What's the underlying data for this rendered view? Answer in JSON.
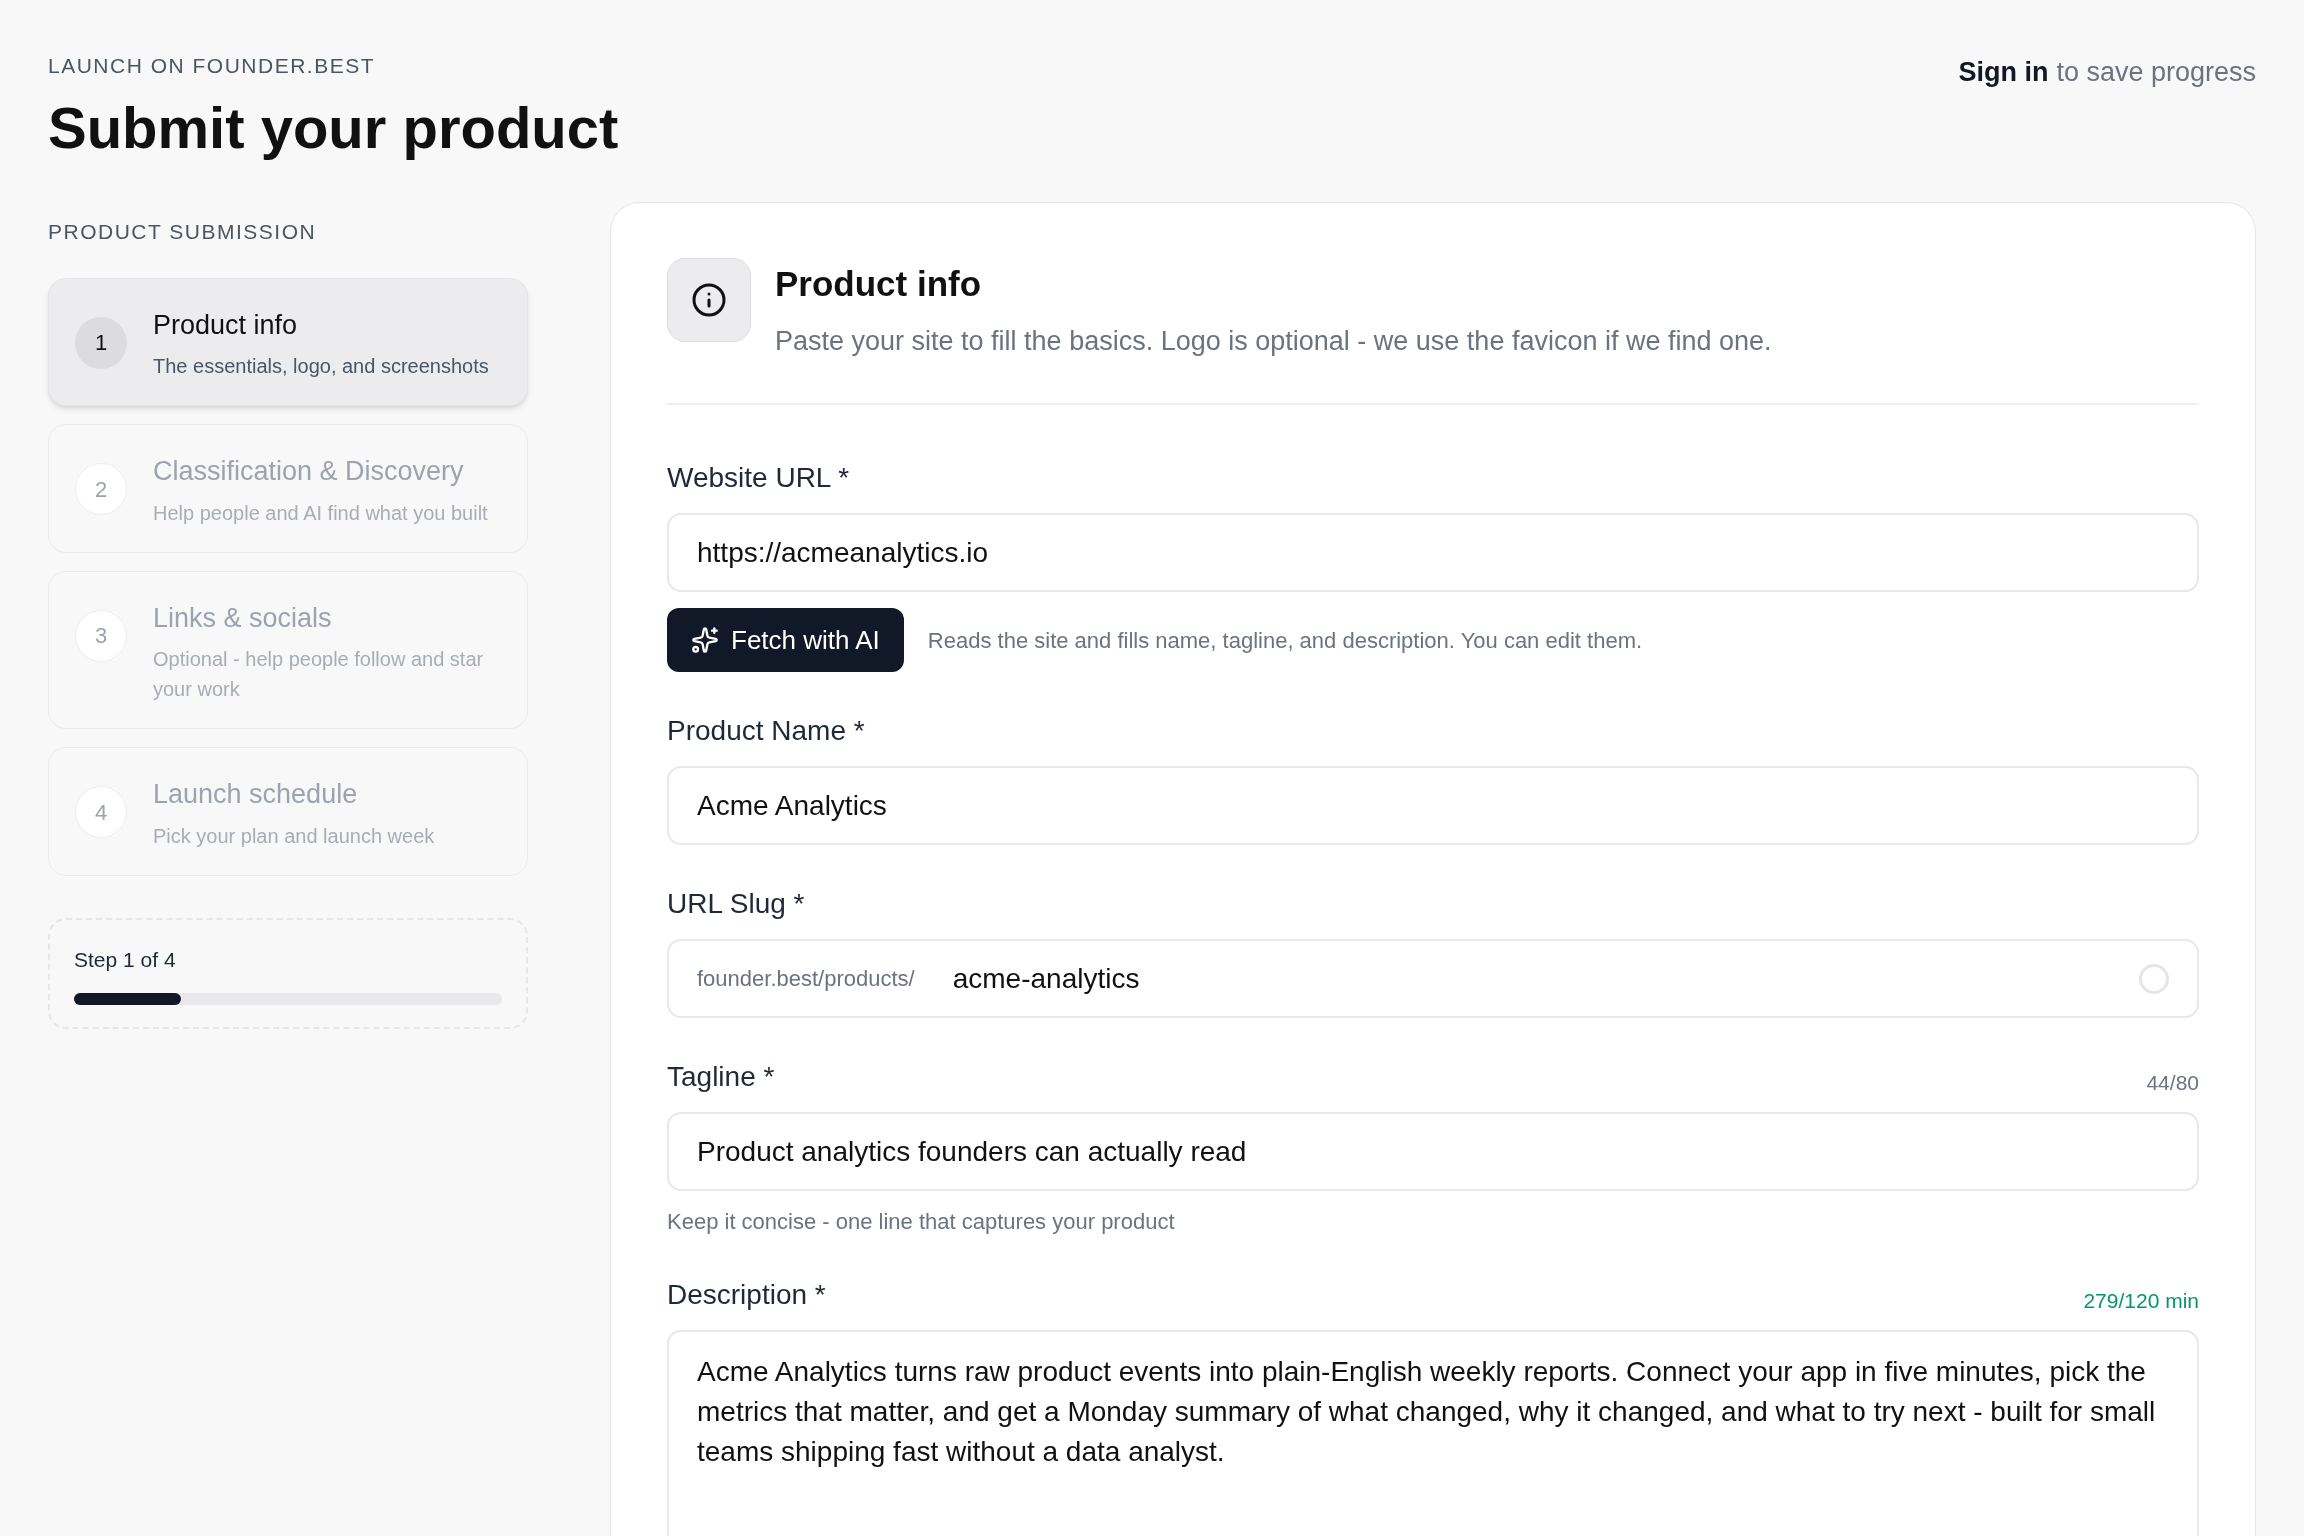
{
  "header": {
    "eyebrow": "LAUNCH ON FOUNDER.BEST",
    "title": "Submit your product",
    "signin_link": "Sign in",
    "signin_suffix": "to save progress"
  },
  "sidebar": {
    "heading": "PRODUCT SUBMISSION",
    "steps": [
      {
        "number": "1",
        "title": "Product info",
        "subtitle": "The essentials, logo, and screenshots",
        "selected": true
      },
      {
        "number": "2",
        "title": "Classification & Discovery",
        "subtitle": "Help people and AI find what you built",
        "selected": false
      },
      {
        "number": "3",
        "title": "Links & socials",
        "subtitle": "Optional - help people follow and star your work",
        "selected": false
      },
      {
        "number": "4",
        "title": "Launch schedule",
        "subtitle": "Pick your plan and launch week",
        "selected": false
      }
    ],
    "progress": {
      "label": "Step 1 of 4",
      "level": 0.25
    }
  },
  "form": {
    "title": "Product info",
    "subtitle": "Paste your site to fill the basics. Logo is optional - we use the favicon if we find one.",
    "website": {
      "label": "Website URL *",
      "value": "https://acmeanalytics.io"
    },
    "fetch": {
      "button": "Fetch with AI",
      "note": "Reads the site and fills name, tagline, and description. You can edit them."
    },
    "name": {
      "label": "Product Name *",
      "value": "Acme Analytics"
    },
    "slug": {
      "label": "URL Slug *",
      "prefix": "founder.best/products/",
      "value": "acme-analytics"
    },
    "tagline": {
      "label": "Tagline *",
      "counter": "44/80",
      "counter_ok": false,
      "value": "Product analytics founders can actually read",
      "hint": "Keep it concise - one line that captures your product"
    },
    "description": {
      "label": "Description *",
      "counter": "279/120 min",
      "counter_ok": true,
      "value": "Acme Analytics turns raw product events into plain-English weekly reports. Connect your app in five minutes, pick the metrics that matter, and get a Monday summary of what changed, why it changed, and what to try next - built for small teams shipping fast without a data analyst."
    }
  }
}
